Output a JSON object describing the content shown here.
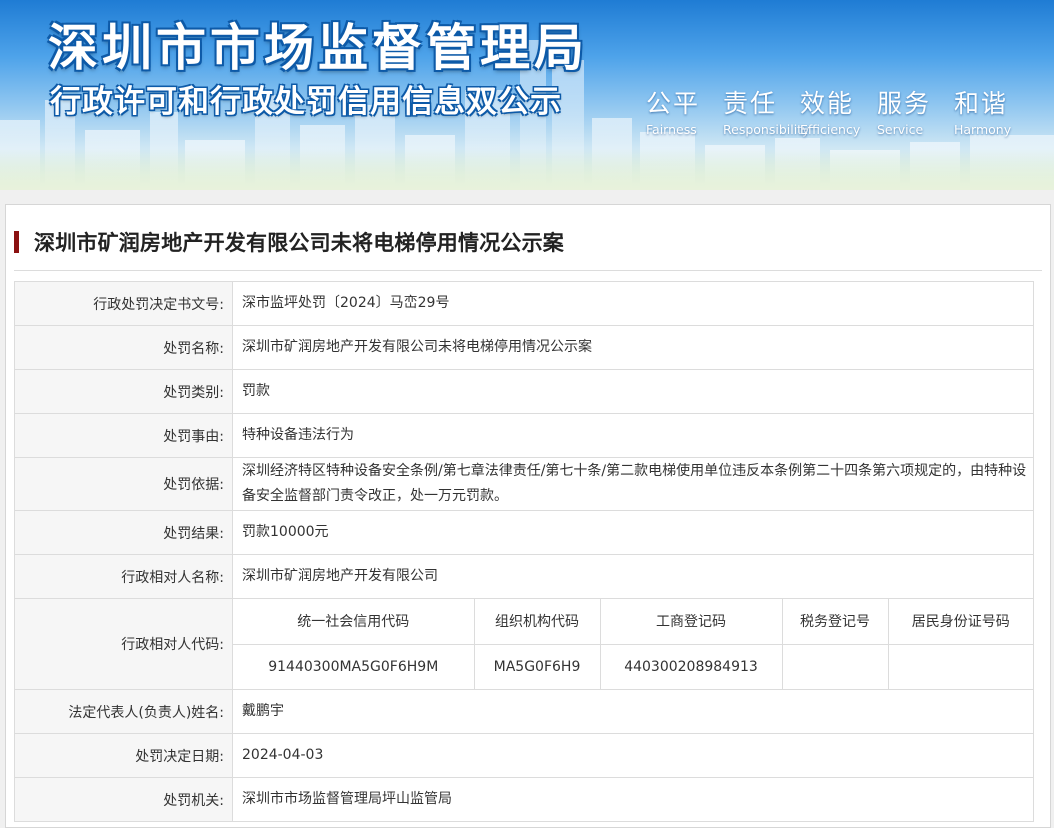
{
  "banner": {
    "title": "深圳市市场监督管理局",
    "subtitle": "行政许可和行政处罚信用信息双公示",
    "slogans": [
      {
        "cn": "公平",
        "en": "Fairness"
      },
      {
        "cn": "责任",
        "en": "Responsibility"
      },
      {
        "cn": "效能",
        "en": "Efficiency"
      },
      {
        "cn": "服务",
        "en": "Service"
      },
      {
        "cn": "和谐",
        "en": "Harmony"
      }
    ]
  },
  "page": {
    "title": "深圳市矿润房地产开发有限公司未将电梯停用情况公示案"
  },
  "fields": {
    "doc_no": {
      "label": "行政处罚决定书文号:",
      "value": "深市监坪处罚〔2024〕马峦29号"
    },
    "name": {
      "label": "处罚名称:",
      "value": "深圳市矿润房地产开发有限公司未将电梯停用情况公示案"
    },
    "category": {
      "label": "处罚类别:",
      "value": "罚款"
    },
    "reason": {
      "label": "处罚事由:",
      "value": "特种设备违法行为"
    },
    "basis": {
      "label": "处罚依据:",
      "value": "深圳经济特区特种设备安全条例/第七章法律责任/第七十条/第二款电梯使用单位违反本条例第二十四条第六项规定的，由特种设备安全监督部门责令改正，处一万元罚款。"
    },
    "result": {
      "label": "处罚结果:",
      "value": "罚款10000元"
    },
    "party_name": {
      "label": "行政相对人名称:",
      "value": "深圳市矿润房地产开发有限公司"
    },
    "party_code": {
      "label": "行政相对人代码:"
    },
    "legal_rep": {
      "label": "法定代表人(负责人)姓名:",
      "value": "戴鹏宇"
    },
    "date": {
      "label": "处罚决定日期:",
      "value": "2024-04-03"
    },
    "authority": {
      "label": "处罚机关:",
      "value": "深圳市市场监督管理局坪山监管局"
    }
  },
  "codes": {
    "headers": [
      "统一社会信用代码",
      "组织机构代码",
      "工商登记码",
      "税务登记号",
      "居民身份证号码"
    ],
    "values": [
      "91440300MA5G0F6H9M",
      "MA5G0F6H9",
      "440300208984913",
      "",
      ""
    ]
  }
}
